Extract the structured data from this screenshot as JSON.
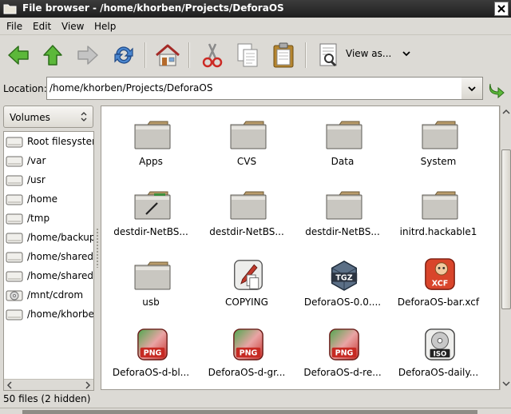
{
  "window": {
    "title": "File browser - /home/khorben/Projects/DeforaOS"
  },
  "menu": {
    "items": [
      {
        "label": "File"
      },
      {
        "label": "Edit"
      },
      {
        "label": "View"
      },
      {
        "label": "Help"
      }
    ]
  },
  "toolbar": {
    "buttons": [
      {
        "icon": "back-arrow-icon",
        "color": "#4aa52e"
      },
      {
        "icon": "up-arrow-icon",
        "color": "#4aa52e"
      },
      {
        "icon": "forward-arrow-icon",
        "color": "#a9a9a9"
      },
      {
        "icon": "refresh-icon",
        "color": "#2f6fb8"
      },
      {
        "icon": "home-icon",
        "color": "#c9302c"
      },
      {
        "icon": "cut-icon",
        "color": "#c9302c"
      },
      {
        "icon": "copy-icon"
      },
      {
        "icon": "paste-icon"
      },
      {
        "icon": "properties-icon"
      }
    ],
    "view_as_label": "View as..."
  },
  "location": {
    "label": "Location:",
    "value": "/home/khorben/Projects/DeforaOS"
  },
  "sidebar": {
    "selector_label": "Volumes",
    "volumes": [
      {
        "label": "Root filesystem",
        "icon": "drive-icon"
      },
      {
        "label": "/var",
        "icon": "drive-icon"
      },
      {
        "label": "/usr",
        "icon": "drive-icon"
      },
      {
        "label": "/home",
        "icon": "drive-icon"
      },
      {
        "label": "/tmp",
        "icon": "drive-icon"
      },
      {
        "label": "/home/backup",
        "icon": "drive-icon"
      },
      {
        "label": "/home/shared",
        "icon": "drive-icon"
      },
      {
        "label": "/home/shared/v",
        "icon": "drive-icon"
      },
      {
        "label": "/mnt/cdrom",
        "icon": "cdrom-icon"
      },
      {
        "label": "/home/khorben",
        "icon": "drive-icon"
      }
    ]
  },
  "files": [
    {
      "name": "Apps",
      "type": "folder"
    },
    {
      "name": "CVS",
      "type": "folder"
    },
    {
      "name": "Data",
      "type": "folder"
    },
    {
      "name": "System",
      "type": "folder"
    },
    {
      "name": "destdir-NetBS...",
      "type": "folder-link"
    },
    {
      "name": "destdir-NetBS...",
      "type": "folder"
    },
    {
      "name": "destdir-NetBS...",
      "type": "folder"
    },
    {
      "name": "initrd.hackable1",
      "type": "folder"
    },
    {
      "name": "usb",
      "type": "folder"
    },
    {
      "name": "COPYING",
      "type": "text"
    },
    {
      "name": "DeforaOS-0.0....",
      "type": "tgz",
      "badge": "TGZ"
    },
    {
      "name": "DeforaOS-bar.xcf",
      "type": "xcf",
      "badge": "XCF"
    },
    {
      "name": "DeforaOS-d-bl...",
      "type": "png",
      "badge": "PNG"
    },
    {
      "name": "DeforaOS-d-gr...",
      "type": "png",
      "badge": "PNG"
    },
    {
      "name": "DeforaOS-d-re...",
      "type": "png",
      "badge": "PNG"
    },
    {
      "name": "DeforaOS-daily...",
      "type": "iso",
      "badge": "ISO"
    }
  ],
  "status": {
    "text": "50 files (2 hidden)"
  }
}
